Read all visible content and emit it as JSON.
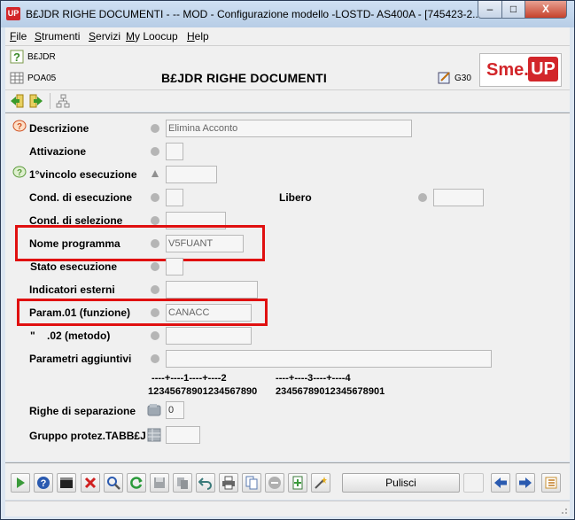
{
  "window": {
    "badge": "UP",
    "title": "B£JDR RIGHE DOCUMENTI -  -- MOD - Configurazione modello -LOSTD- AS400A  - [745423-2...",
    "minimize": "–",
    "maximize": "□",
    "close": "X"
  },
  "menu": {
    "file_u": "F",
    "file_rest": "ile",
    "strumenti_u": "S",
    "strumenti_rest": "trumenti",
    "servizi_u": "S",
    "servizi_rest": "ervizi",
    "myloocup_u": "M",
    "myloocup_rest": "y Loocup",
    "help_u": "H",
    "help_rest": "elp"
  },
  "header": {
    "code1": "B£JDR",
    "code2": "POA05",
    "title": "B£JDR RIGHE DOCUMENTI",
    "g30": "G30",
    "logo_sme": "Sme.",
    "logo_up": "UP"
  },
  "form": {
    "descrizione_label": "Descrizione",
    "descrizione_value": "Elimina Acconto",
    "attivazione_label": "Attivazione",
    "vincolo_label": "1°vincolo esecuzione",
    "cond_esec_label": "Cond. di esecuzione",
    "libero_label": "Libero",
    "cond_sel_label": "Cond. di selezione",
    "nome_prog_label": "Nome programma",
    "nome_prog_value": "V5FUANT",
    "stato_label": "Stato esecuzione",
    "indicatori_label": "Indicatori esterni",
    "param01_label": "Param.01 (funzione)",
    "param01_value": "CANACC",
    "param02_quote": "\"",
    "param02_label": ".02 (metodo)",
    "param_agg_label": "Parametri aggiuntivi",
    "ruler_top_1": "----+----1----+----2",
    "ruler_top_2": "----+----3----+----4",
    "ruler_bottom_1": "12345678901234567890",
    "ruler_bottom_2": "23456789012345678901",
    "righe_sep_label": "Righe di separazione",
    "righe_sep_value": "0",
    "gruppo_label": "Gruppo protez.TABB£J"
  },
  "bottom": {
    "pulisci_label": "Pulisci"
  },
  "colors": {
    "highlight": "#e01010",
    "brand_red": "#d2262a",
    "panel": "#f0f0f0"
  }
}
